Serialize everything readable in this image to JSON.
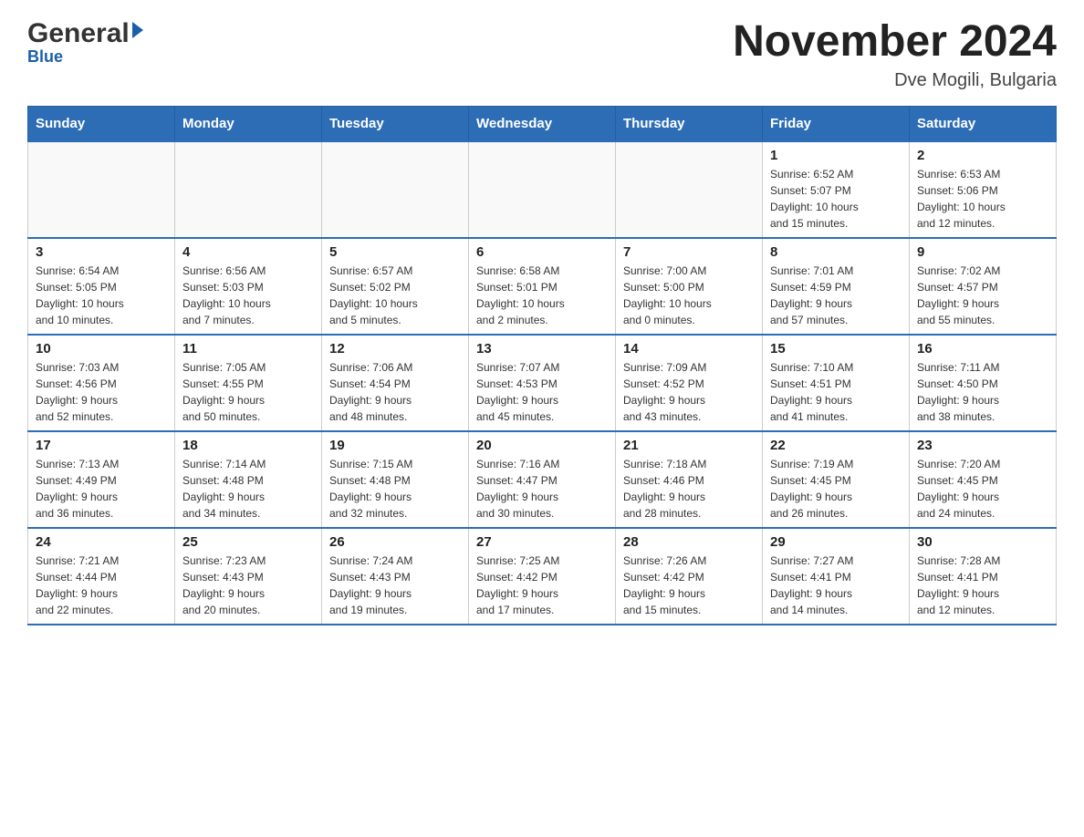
{
  "header": {
    "logo_general": "General",
    "logo_blue": "Blue",
    "month_title": "November 2024",
    "location": "Dve Mogili, Bulgaria"
  },
  "weekdays": [
    "Sunday",
    "Monday",
    "Tuesday",
    "Wednesday",
    "Thursday",
    "Friday",
    "Saturday"
  ],
  "weeks": [
    [
      {
        "day": "",
        "info": ""
      },
      {
        "day": "",
        "info": ""
      },
      {
        "day": "",
        "info": ""
      },
      {
        "day": "",
        "info": ""
      },
      {
        "day": "",
        "info": ""
      },
      {
        "day": "1",
        "info": "Sunrise: 6:52 AM\nSunset: 5:07 PM\nDaylight: 10 hours\nand 15 minutes."
      },
      {
        "day": "2",
        "info": "Sunrise: 6:53 AM\nSunset: 5:06 PM\nDaylight: 10 hours\nand 12 minutes."
      }
    ],
    [
      {
        "day": "3",
        "info": "Sunrise: 6:54 AM\nSunset: 5:05 PM\nDaylight: 10 hours\nand 10 minutes."
      },
      {
        "day": "4",
        "info": "Sunrise: 6:56 AM\nSunset: 5:03 PM\nDaylight: 10 hours\nand 7 minutes."
      },
      {
        "day": "5",
        "info": "Sunrise: 6:57 AM\nSunset: 5:02 PM\nDaylight: 10 hours\nand 5 minutes."
      },
      {
        "day": "6",
        "info": "Sunrise: 6:58 AM\nSunset: 5:01 PM\nDaylight: 10 hours\nand 2 minutes."
      },
      {
        "day": "7",
        "info": "Sunrise: 7:00 AM\nSunset: 5:00 PM\nDaylight: 10 hours\nand 0 minutes."
      },
      {
        "day": "8",
        "info": "Sunrise: 7:01 AM\nSunset: 4:59 PM\nDaylight: 9 hours\nand 57 minutes."
      },
      {
        "day": "9",
        "info": "Sunrise: 7:02 AM\nSunset: 4:57 PM\nDaylight: 9 hours\nand 55 minutes."
      }
    ],
    [
      {
        "day": "10",
        "info": "Sunrise: 7:03 AM\nSunset: 4:56 PM\nDaylight: 9 hours\nand 52 minutes."
      },
      {
        "day": "11",
        "info": "Sunrise: 7:05 AM\nSunset: 4:55 PM\nDaylight: 9 hours\nand 50 minutes."
      },
      {
        "day": "12",
        "info": "Sunrise: 7:06 AM\nSunset: 4:54 PM\nDaylight: 9 hours\nand 48 minutes."
      },
      {
        "day": "13",
        "info": "Sunrise: 7:07 AM\nSunset: 4:53 PM\nDaylight: 9 hours\nand 45 minutes."
      },
      {
        "day": "14",
        "info": "Sunrise: 7:09 AM\nSunset: 4:52 PM\nDaylight: 9 hours\nand 43 minutes."
      },
      {
        "day": "15",
        "info": "Sunrise: 7:10 AM\nSunset: 4:51 PM\nDaylight: 9 hours\nand 41 minutes."
      },
      {
        "day": "16",
        "info": "Sunrise: 7:11 AM\nSunset: 4:50 PM\nDaylight: 9 hours\nand 38 minutes."
      }
    ],
    [
      {
        "day": "17",
        "info": "Sunrise: 7:13 AM\nSunset: 4:49 PM\nDaylight: 9 hours\nand 36 minutes."
      },
      {
        "day": "18",
        "info": "Sunrise: 7:14 AM\nSunset: 4:48 PM\nDaylight: 9 hours\nand 34 minutes."
      },
      {
        "day": "19",
        "info": "Sunrise: 7:15 AM\nSunset: 4:48 PM\nDaylight: 9 hours\nand 32 minutes."
      },
      {
        "day": "20",
        "info": "Sunrise: 7:16 AM\nSunset: 4:47 PM\nDaylight: 9 hours\nand 30 minutes."
      },
      {
        "day": "21",
        "info": "Sunrise: 7:18 AM\nSunset: 4:46 PM\nDaylight: 9 hours\nand 28 minutes."
      },
      {
        "day": "22",
        "info": "Sunrise: 7:19 AM\nSunset: 4:45 PM\nDaylight: 9 hours\nand 26 minutes."
      },
      {
        "day": "23",
        "info": "Sunrise: 7:20 AM\nSunset: 4:45 PM\nDaylight: 9 hours\nand 24 minutes."
      }
    ],
    [
      {
        "day": "24",
        "info": "Sunrise: 7:21 AM\nSunset: 4:44 PM\nDaylight: 9 hours\nand 22 minutes."
      },
      {
        "day": "25",
        "info": "Sunrise: 7:23 AM\nSunset: 4:43 PM\nDaylight: 9 hours\nand 20 minutes."
      },
      {
        "day": "26",
        "info": "Sunrise: 7:24 AM\nSunset: 4:43 PM\nDaylight: 9 hours\nand 19 minutes."
      },
      {
        "day": "27",
        "info": "Sunrise: 7:25 AM\nSunset: 4:42 PM\nDaylight: 9 hours\nand 17 minutes."
      },
      {
        "day": "28",
        "info": "Sunrise: 7:26 AM\nSunset: 4:42 PM\nDaylight: 9 hours\nand 15 minutes."
      },
      {
        "day": "29",
        "info": "Sunrise: 7:27 AM\nSunset: 4:41 PM\nDaylight: 9 hours\nand 14 minutes."
      },
      {
        "day": "30",
        "info": "Sunrise: 7:28 AM\nSunset: 4:41 PM\nDaylight: 9 hours\nand 12 minutes."
      }
    ]
  ]
}
